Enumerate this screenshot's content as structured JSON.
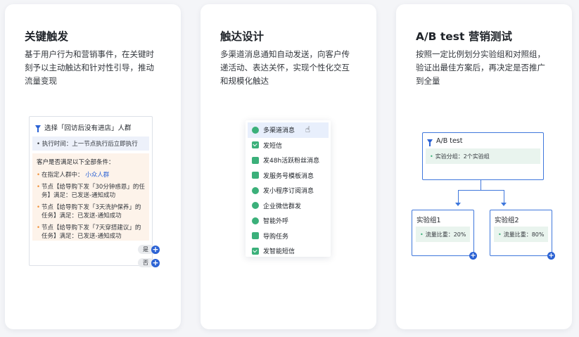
{
  "cards": [
    {
      "title": "关键触发",
      "desc": [
        "基于用户行为和营销事件，在关键时",
        "刻予以主动触达和针对性引导，推动",
        "流量变现"
      ],
      "widget": {
        "head": "选择「回访后没有进店」人群",
        "exec_time": "• 执行时间：上一节点执行后立即执行",
        "cond_title": "客户是否满足以下全部条件：",
        "cond_prefix": "在指定人群中：",
        "cond_highlight": "小众人群",
        "conds": [
          "节点【给导购下发「30分钟惑恩」的任务】满足：已发送-通知成功",
          "节点【给导购下发「3天洗护保养」的任务】满足：已发送-通知成功",
          "节点【给导购下发「7天穿搭建议」的任务】满足：已发送-通知成功"
        ],
        "yes_label": "是",
        "no_label": "否"
      }
    },
    {
      "title": "触达设计",
      "desc": [
        "多渠道消息通知自动发送，向客户传",
        "递活动、表达关怀，实现个性化交互",
        "和规模化触达"
      ],
      "menu": [
        {
          "label": "多渠道消息",
          "icon": "omnichannel-icon",
          "color": "#3bb07a"
        },
        {
          "label": "发短信",
          "icon": "sms-icon",
          "color": "#3bb07a"
        },
        {
          "label": "发48h活跃粉丝消息",
          "icon": "fan-message-icon",
          "color": "#3bb07a"
        },
        {
          "label": "发服务号模板消息",
          "icon": "template-message-icon",
          "color": "#3bb07a"
        },
        {
          "label": "发小程序订阅消息",
          "icon": "miniprogram-icon",
          "color": "#3bb07a"
        },
        {
          "label": "企业微信群发",
          "icon": "wecom-broadcast-icon",
          "color": "#3bb07a"
        },
        {
          "label": "智能外呼",
          "icon": "smart-call-icon",
          "color": "#3bb07a"
        },
        {
          "label": "导购任务",
          "icon": "guide-task-icon",
          "color": "#3bb07a"
        },
        {
          "label": "发智能短信",
          "icon": "smart-sms-icon",
          "color": "#3bb07a"
        }
      ]
    },
    {
      "title": "A/B test 营销测试",
      "desc": [
        "按照一定比例划分实验组和对照组，",
        "验证出最佳方案后，再决定是否推广",
        "到全量"
      ],
      "ab": {
        "root_title": "A/B test",
        "root_detail": "实验分组：2个实验组",
        "groups": [
          {
            "title": "实验组1",
            "detail": "流量比重：20%"
          },
          {
            "title": "实验组2",
            "detail": "流量比重：80%"
          }
        ]
      }
    }
  ],
  "colors": {
    "accent": "#2b62d4",
    "green": "#3bb07a",
    "orange": "#f0923b"
  }
}
